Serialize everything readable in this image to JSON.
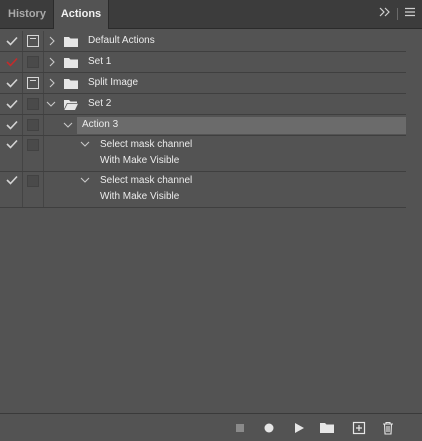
{
  "tabs": [
    {
      "label": "History",
      "active": false
    },
    {
      "label": "Actions",
      "active": true
    }
  ],
  "header_icons": [
    "expand-panel-icon",
    "panel-menu-icon"
  ],
  "actions": {
    "rows": [
      {
        "label": "Default Actions",
        "checked": true,
        "check_color": "#d4d4d4",
        "dialog": true,
        "expander": "collapsed",
        "type": "folder"
      },
      {
        "label": "Set 1",
        "checked": true,
        "check_color": "#c42b2b",
        "dialog": false,
        "expander": "collapsed",
        "type": "folder"
      },
      {
        "label": "Split Image",
        "checked": true,
        "check_color": "#d4d4d4",
        "dialog": true,
        "expander": "collapsed",
        "type": "folder"
      },
      {
        "label": "Set 2",
        "checked": true,
        "check_color": "#d4d4d4",
        "dialog": false,
        "expander": "expanded",
        "type": "folder-open"
      },
      {
        "label": "Action 3",
        "checked": true,
        "check_color": "#d4d4d4",
        "dialog": false,
        "expander": "expanded",
        "type": "action",
        "selected": true
      },
      {
        "label": "Select mask channel",
        "detail": "With Make Visible",
        "checked": true,
        "check_color": "#d4d4d4",
        "dialog": false,
        "expander": "expanded",
        "type": "step"
      },
      {
        "label": "Select mask channel",
        "detail": "With Make Visible",
        "checked": true,
        "check_color": "#d4d4d4",
        "dialog": false,
        "expander": "expanded",
        "type": "step"
      }
    ]
  },
  "footer_tools": [
    "stop-icon",
    "record-icon",
    "play-icon",
    "new-set-icon",
    "new-action-icon",
    "delete-icon"
  ],
  "colors": {
    "panel_bg": "#535353",
    "tab_bar_bg": "#3c3c3c",
    "selected_row_bg": "#6b6b6b",
    "record_check_red": "#c42b2b"
  }
}
